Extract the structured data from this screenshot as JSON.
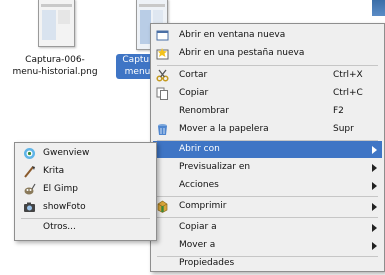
{
  "desktop": {
    "files": [
      {
        "name_line1": "Captura-006-",
        "name_line2": "menu-historial.png"
      },
      {
        "name_line1": "Captura-",
        "name_line2": "menu-h"
      }
    ]
  },
  "context_menu": {
    "items": [
      {
        "label": "Abrir en ventana nueva",
        "icon": "new-window-icon"
      },
      {
        "label": "Abrir en una pestaña nueva",
        "icon": "new-tab-icon"
      },
      {
        "label": "Cortar",
        "shortcut": "Ctrl+X",
        "icon": "cut-icon"
      },
      {
        "label": "Copiar",
        "shortcut": "Ctrl+C",
        "icon": "copy-icon"
      },
      {
        "label": "Renombrar",
        "shortcut": "F2"
      },
      {
        "label": "Mover a la papelera",
        "shortcut": "Supr",
        "icon": "trash-icon"
      },
      {
        "label": "Abrir con",
        "submenu": true,
        "highlighted": true
      },
      {
        "label": "Previsualizar en",
        "submenu": true
      },
      {
        "label": "Acciones",
        "submenu": true
      },
      {
        "label": "Comprimir",
        "submenu": true,
        "icon": "compress-icon"
      },
      {
        "label": "Copiar a",
        "submenu": true
      },
      {
        "label": "Mover a",
        "submenu": true
      },
      {
        "label": "Propiedades"
      }
    ]
  },
  "open_with_menu": {
    "items": [
      {
        "label": "Gwenview",
        "icon": "gwenview-icon"
      },
      {
        "label": "Krita",
        "icon": "krita-icon"
      },
      {
        "label": "El Gimp",
        "icon": "gimp-icon"
      },
      {
        "label": "showFoto",
        "icon": "showfoto-icon"
      },
      {
        "label": "Otros..."
      }
    ]
  },
  "colors": {
    "highlight": "#3f75c5",
    "menu_background": "#efefef"
  }
}
